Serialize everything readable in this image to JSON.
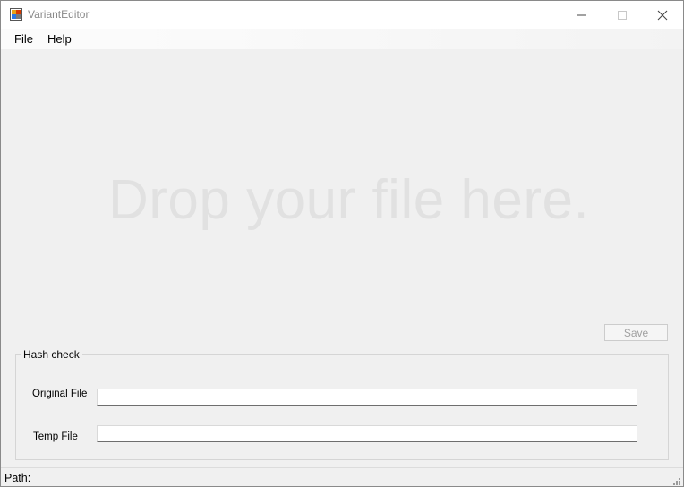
{
  "window": {
    "title": "VariantEditor",
    "icons": {
      "app": "app-icon",
      "minimize": "minimize-icon",
      "maximize": "maximize-icon",
      "close": "close-icon"
    }
  },
  "menu": {
    "items": [
      {
        "label": "File"
      },
      {
        "label": "Help"
      }
    ]
  },
  "drop_zone": {
    "text": "Drop your file here."
  },
  "save_button": {
    "label": "Save",
    "enabled": false
  },
  "hash_check": {
    "title": "Hash check",
    "original_file": {
      "label": "Original File",
      "value": ""
    },
    "temp_file": {
      "label": "Temp File",
      "value": ""
    }
  },
  "status": {
    "path_label": "Path:"
  },
  "colors": {
    "background": "#f0f0f0",
    "drop_text": "#e1e1e1",
    "disabled_text": "#a0a0a0"
  }
}
